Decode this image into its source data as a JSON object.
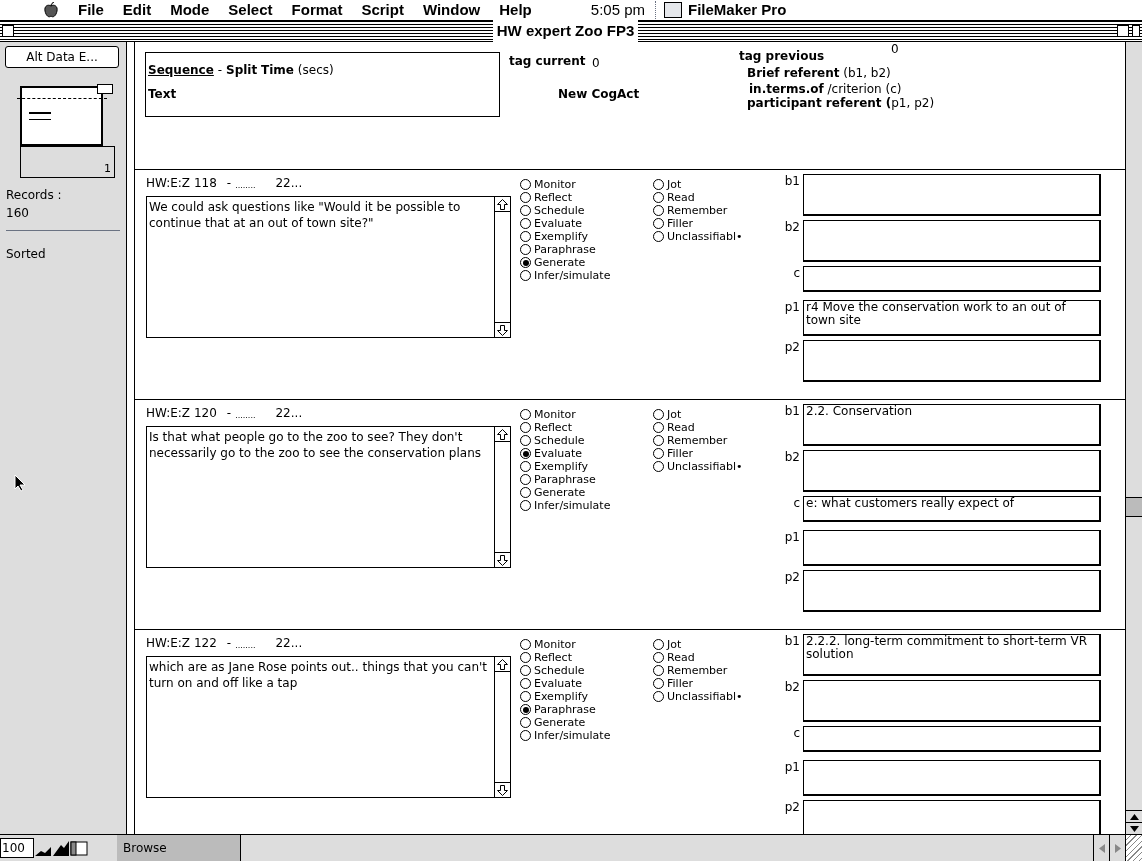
{
  "menu_bar": {
    "items": [
      "File",
      "Edit",
      "Mode",
      "Select",
      "Format",
      "Script",
      "Window",
      "Help"
    ],
    "clock": "5:05 pm",
    "app": "FileMaker Pro"
  },
  "window": {
    "title": "HW expert Zoo FP3"
  },
  "sidebar": {
    "button": "Alt Data E...",
    "page": "1",
    "records_label": "Records :",
    "records_count": "160",
    "sort_state": "Sorted"
  },
  "header": {
    "sequence": "Sequence",
    "sequence_rest": "- **Split**   **Time** (secs)",
    "text": "Text",
    "tag_current": "tag current",
    "tag_current_value": "0",
    "new_cogact": "New CogAct",
    "tag_previous": "tag previous",
    "tag_previous_value": "0",
    "brief_referent": "**Brief referent** (b1, b2)",
    "in_terms_of": "**in.terms.of** /criterion (c)",
    "participant_referent": "**participant referent (**p1, p2)"
  },
  "records": [
    {
      "id": "HW:E:Z 118",
      "dash": "-",
      "dots": "........",
      "num": "22...",
      "text": "We could ask questions like \"Would it be possible to continue that at an out of town site?\"",
      "options": [
        {
          "label": "Monitor",
          "selected": false
        },
        {
          "label": "Reflect",
          "selected": false
        },
        {
          "label": "Schedule",
          "selected": false
        },
        {
          "label": "Evaluate",
          "selected": false
        },
        {
          "label": "Exemplify",
          "selected": false
        },
        {
          "label": "Paraphrase",
          "selected": false
        },
        {
          "label": "Generate",
          "selected": true
        },
        {
          "label": "Infer/simulate",
          "selected": false
        },
        {
          "label": "Jot",
          "selected": false
        },
        {
          "label": "Read",
          "selected": false
        },
        {
          "label": "Remember",
          "selected": false
        },
        {
          "label": "Filler",
          "selected": false
        },
        {
          "label": "Unclassifiabl•",
          "selected": false
        }
      ],
      "fields": [
        {
          "label": "b1",
          "kind": "tall"
        },
        {
          "label": "b2",
          "kind": "tall"
        },
        {
          "label": "c",
          "kind": "short"
        },
        {
          "label": "p1",
          "kind": "mid",
          "value": "r4 Move the conservation work to an out of town site"
        },
        {
          "label": "p2",
          "kind": "tall"
        }
      ]
    },
    {
      "id": "HW:E:Z 120",
      "dash": "-",
      "dots": "........",
      "num": "22...",
      "text": " Is that what people go to the zoo to see?  They don't necessarily go to the zoo to see the conservation plans",
      "options": [
        {
          "label": "Monitor",
          "selected": false
        },
        {
          "label": "Reflect",
          "selected": false
        },
        {
          "label": "Schedule",
          "selected": false
        },
        {
          "label": "Evaluate",
          "selected": true
        },
        {
          "label": "Exemplify",
          "selected": false
        },
        {
          "label": "Paraphrase",
          "selected": false
        },
        {
          "label": "Generate",
          "selected": false
        },
        {
          "label": "Infer/simulate",
          "selected": false
        },
        {
          "label": "Jot",
          "selected": false
        },
        {
          "label": "Read",
          "selected": false
        },
        {
          "label": "Remember",
          "selected": false
        },
        {
          "label": "Filler",
          "selected": false
        },
        {
          "label": "Unclassifiabl•",
          "selected": false
        }
      ],
      "fields": [
        {
          "label": "b1",
          "kind": "tall",
          "value": "  2.2. Conservation"
        },
        {
          "label": "b2",
          "kind": "tall"
        },
        {
          "label": "c",
          "kind": "short",
          "value": "e: what customers really expect of"
        },
        {
          "label": "p1",
          "kind": "mid"
        },
        {
          "label": "p2",
          "kind": "tall"
        }
      ]
    },
    {
      "id": "HW:E:Z 122",
      "dash": "-",
      "dots": "........",
      "num": "22...",
      "text": " which are as Jane Rose points out.. things that you can't turn on and off like a tap",
      "options": [
        {
          "label": "Monitor",
          "selected": false
        },
        {
          "label": "Reflect",
          "selected": false
        },
        {
          "label": "Schedule",
          "selected": false
        },
        {
          "label": "Evaluate",
          "selected": false
        },
        {
          "label": "Exemplify",
          "selected": false
        },
        {
          "label": "Paraphrase",
          "selected": true
        },
        {
          "label": "Generate",
          "selected": false
        },
        {
          "label": "Infer/simulate",
          "selected": false
        },
        {
          "label": "Jot",
          "selected": false
        },
        {
          "label": "Read",
          "selected": false
        },
        {
          "label": "Remember",
          "selected": false
        },
        {
          "label": "Filler",
          "selected": false
        },
        {
          "label": "Unclassifiabl•",
          "selected": false
        }
      ],
      "fields": [
        {
          "label": "b1",
          "kind": "tall",
          "value": "  2.2.2. long-term commitment to short-term VR solution"
        },
        {
          "label": "b2",
          "kind": "tall"
        },
        {
          "label": "c",
          "kind": "short"
        },
        {
          "label": "p1",
          "kind": "mid"
        },
        {
          "label": "p2",
          "kind": "tall"
        }
      ]
    }
  ],
  "status_bar": {
    "zoom": "100",
    "mode": "Browse"
  }
}
